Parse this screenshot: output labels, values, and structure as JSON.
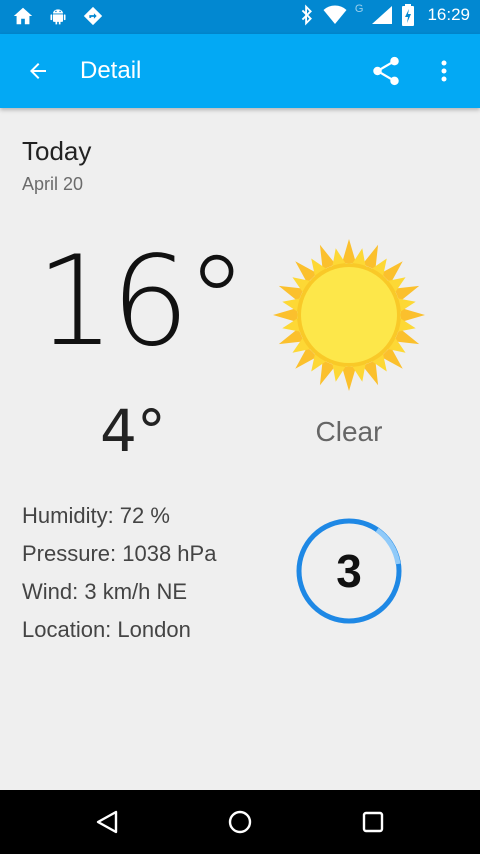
{
  "status_bar": {
    "time": "16:29",
    "network_label": "G",
    "icons": [
      "home-icon",
      "android-icon",
      "navigation-icon",
      "bluetooth-icon",
      "wifi-icon",
      "cell-signal-icon",
      "battery-icon"
    ]
  },
  "app_bar": {
    "title": "Detail",
    "icons": [
      "back-arrow-icon",
      "share-icon",
      "more-vert-icon"
    ],
    "background": "#03a9f4",
    "status_background": "#0288d1"
  },
  "forecast": {
    "day": "Today",
    "date": "April 20",
    "high": "16°",
    "low": "4°",
    "condition": "Clear",
    "condition_icon": "sun-icon",
    "humidity": "Humidity: 72 %",
    "pressure": "Pressure: 1038 hPa",
    "wind": "Wind: 3 km/h NE",
    "location": "Location: London",
    "wind_dial": {
      "value": "3",
      "color": "#1e88e5"
    }
  },
  "nav_bar": {
    "icons": [
      "back-triangle-icon",
      "home-circle-icon",
      "recents-square-icon"
    ]
  }
}
